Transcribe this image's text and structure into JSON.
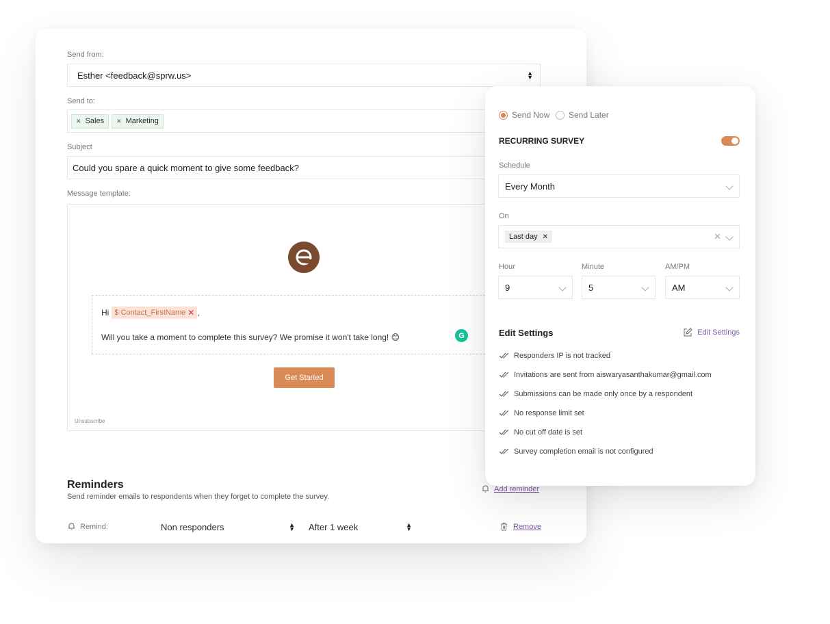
{
  "compose": {
    "send_from_label": "Send from:",
    "send_from_value": "Esther <feedback@sprw.us>",
    "send_to_label": "Send to:",
    "send_to_tags": [
      "Sales",
      "Marketing"
    ],
    "subject_label": "Subject",
    "subject_value": "Could you spare a quick moment to give some feedback?",
    "template_label": "Message template:",
    "greeting": "Hi",
    "merge_field": "$ Contact_FirstName",
    "greeting_suffix": ",",
    "body_text": "Will you take a moment to complete this survey? We promise it won't take long! 😊",
    "cta_label": "Get Started",
    "unsubscribe_label": "Unsubscribe"
  },
  "reminders": {
    "title": "Reminders",
    "subtitle": "Send reminder emails to respondents when they forget to complete the survey.",
    "add_label": "Add reminder",
    "remind_label": "Remind:",
    "who_value": "Non responders",
    "when_value": "After 1 week",
    "remove_label": "Remove"
  },
  "schedule_panel": {
    "send_now_label": "Send Now",
    "send_later_label": "Send Later",
    "send_mode": "now",
    "recurring_title": "RECURRING SURVEY",
    "recurring_enabled": true,
    "schedule_label": "Schedule",
    "schedule_value": "Every Month",
    "on_label": "On",
    "on_tag": "Last day",
    "hour_label": "Hour",
    "hour_value": "9",
    "minute_label": "Minute",
    "minute_value": "5",
    "ampm_label": "AM/PM",
    "ampm_value": "AM",
    "edit_title": "Edit Settings",
    "edit_link": "Edit Settings",
    "settings": [
      "Responders IP is not tracked",
      "Invitations are sent from aiswaryasanthakumar@gmail.com",
      "Submissions can be made only once by a respondent",
      "No response limit set",
      "No cut off date is set",
      "Survey completion email is not configured"
    ]
  },
  "colors": {
    "accent": "#d88a57",
    "link": "#7b5aa6",
    "logo": "#7a4a2e",
    "tag_bg": "#eaf6ee",
    "merge_bg": "#fbe2d6"
  }
}
